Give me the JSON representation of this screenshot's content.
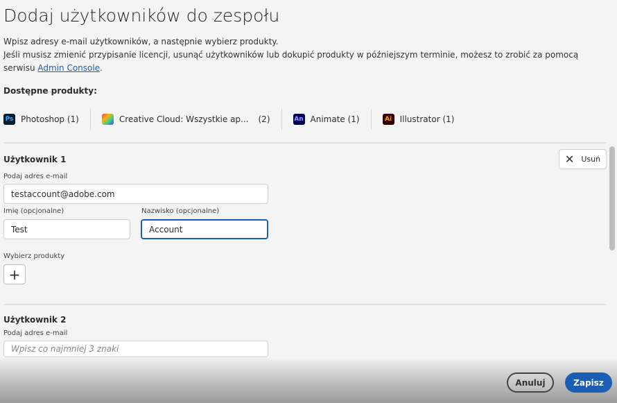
{
  "title": "Dodaj użytkowników do zespołu",
  "desc_line1": "Wpisz adresy e-mail użytkowników, a następnie wybierz produkty.",
  "desc_line2": "Jeśli musisz zmienić przypisanie licencji, usunąć użytkowników lub dokupić produkty w późniejszym terminie, możesz to zrobić za pomocą serwisu ",
  "desc_link": "Admin Console",
  "desc_end": ".",
  "available_label": "Dostępne produkty:",
  "products": [
    {
      "icon": "Ps",
      "label": "Photoshop (1)",
      "bg": "#001e36",
      "fg": "#31a8ff"
    },
    {
      "icon": "cc",
      "label": "Creative Cloud: Wszystkie ap...",
      "count": "(2)"
    },
    {
      "icon": "An",
      "label": "Animate (1)",
      "bg": "#00005b",
      "fg": "#9999ff"
    },
    {
      "icon": "Ai",
      "label": "Illustrator (1)",
      "bg": "#330000",
      "fg": "#ff9a00"
    }
  ],
  "user1": {
    "heading": "Użytkownik 1",
    "remove": "Usuń",
    "email_label": "Podaj adres e-mail",
    "email": "testaccount@adobe.com",
    "first_label": "Imię (opcjonalne)",
    "first": "Test",
    "last_label": "Nazwisko (opcjonalne)",
    "last": "Account",
    "products_label": "Wybierz produkty",
    "add": "+"
  },
  "user2": {
    "heading": "Użytkownik 2",
    "email_label": "Podaj adres e-mail",
    "email_placeholder": "Wpisz co najmniej 3 znaki"
  },
  "footer": {
    "cancel": "Anuluj",
    "save": "Zapisz"
  },
  "colors": {
    "accent": "#1a5fb4"
  }
}
